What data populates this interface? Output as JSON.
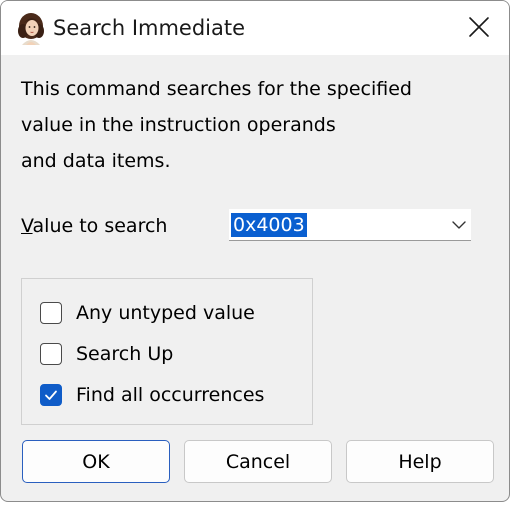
{
  "window": {
    "title": "Search Immediate",
    "app_icon": "portrait-icon",
    "close_icon": "close-icon"
  },
  "description": {
    "lines": [
      "This command searches for the specified",
      "value in the instruction operands",
      "and data items."
    ]
  },
  "value_field": {
    "label_mnemonic": "V",
    "label_rest": "alue to search",
    "value": "0x4003",
    "dropdown_icon": "chevron-down-icon"
  },
  "options": [
    {
      "label": "Any untyped value",
      "checked": false
    },
    {
      "label": "Search Up",
      "checked": false
    },
    {
      "label": "Find all occurrences",
      "checked": true
    }
  ],
  "buttons": {
    "ok": "OK",
    "cancel": "Cancel",
    "help": "Help"
  },
  "colors": {
    "accent": "#0f5cc8",
    "selection": "#0a5fd0",
    "dialog_bg": "#f0f0f0"
  }
}
